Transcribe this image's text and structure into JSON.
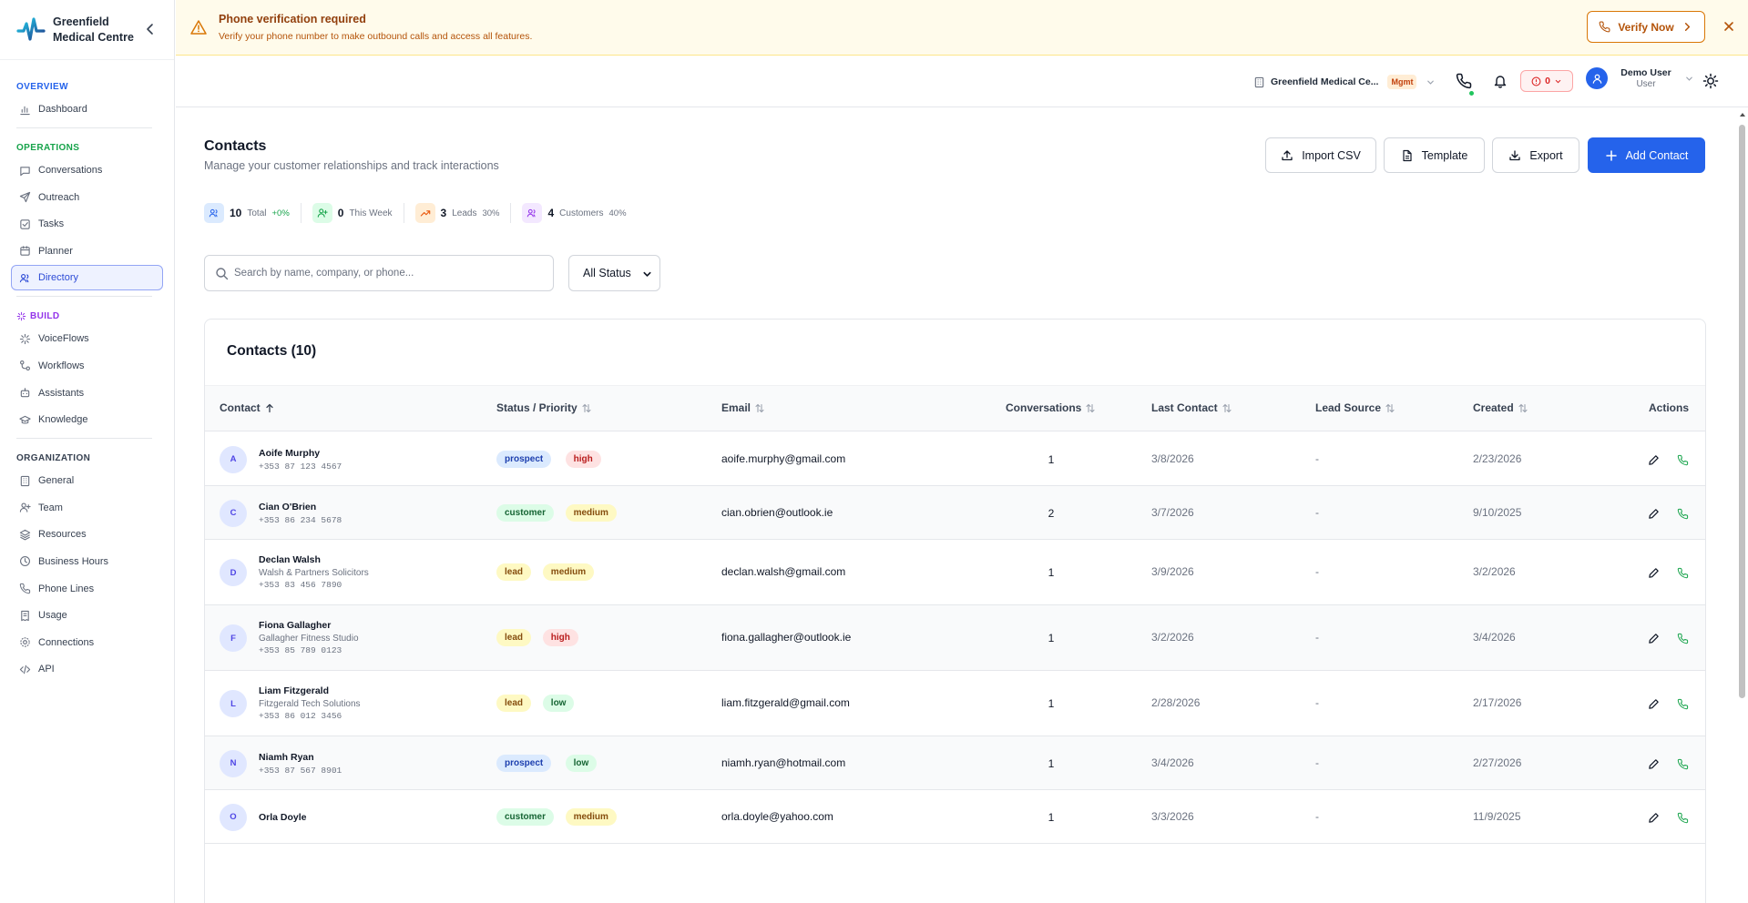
{
  "brand": {
    "name": "Greenfield Medical Centre"
  },
  "sidebar": {
    "sections": [
      {
        "title": "OVERVIEW",
        "color": "#2563eb",
        "items": [
          {
            "label": "Dashboard",
            "icon": "chart-bar-icon"
          }
        ]
      },
      {
        "title": "OPERATIONS",
        "color": "#16a34a",
        "items": [
          {
            "label": "Conversations",
            "icon": "message-icon"
          },
          {
            "label": "Outreach",
            "icon": "send-icon"
          },
          {
            "label": "Tasks",
            "icon": "checkbox-icon"
          },
          {
            "label": "Planner",
            "icon": "calendar-icon"
          },
          {
            "label": "Directory",
            "icon": "users-icon",
            "active": true
          }
        ]
      },
      {
        "title": "BUILD",
        "color": "#9333ea",
        "items": [
          {
            "label": "VoiceFlows",
            "icon": "sparkle-icon"
          },
          {
            "label": "Workflows",
            "icon": "workflow-icon"
          },
          {
            "label": "Assistants",
            "icon": "bot-icon"
          },
          {
            "label": "Knowledge",
            "icon": "graduation-icon"
          }
        ]
      },
      {
        "title": "ORGANIZATION",
        "color": "#374151",
        "items": [
          {
            "label": "General",
            "icon": "building-icon"
          },
          {
            "label": "Team",
            "icon": "user-plus-icon"
          },
          {
            "label": "Resources",
            "icon": "layers-icon"
          },
          {
            "label": "Business Hours",
            "icon": "clock-icon"
          },
          {
            "label": "Phone Lines",
            "icon": "phone-icon"
          },
          {
            "label": "Usage",
            "icon": "receipt-icon"
          },
          {
            "label": "Connections",
            "icon": "settings-icon"
          },
          {
            "label": "API",
            "icon": "code-icon"
          }
        ]
      }
    ]
  },
  "banner": {
    "title": "Phone verification required",
    "subtitle": "Verify your phone number to make outbound calls and access all features.",
    "action_label": "Verify Now"
  },
  "topbar": {
    "org_name": "Greenfield Medical Ce...",
    "org_badge": "Mgmt",
    "alerts_count": "0",
    "user_name": "Demo User",
    "user_role": "User"
  },
  "page": {
    "title": "Contacts",
    "subtitle": "Manage your customer relationships and track interactions",
    "buttons": {
      "import": "Import CSV",
      "template": "Template",
      "export": "Export",
      "add": "Add Contact"
    }
  },
  "stats": [
    {
      "value": "10",
      "label": "Total",
      "extra": "+0%",
      "color": "#2563eb",
      "bg": "#dbeafe",
      "icon": "users-icon"
    },
    {
      "value": "0",
      "label": "This Week",
      "extra": "",
      "color": "#16a34a",
      "bg": "#dcfce7",
      "icon": "user-plus-icon"
    },
    {
      "value": "3",
      "label": "Leads",
      "extra": "30%",
      "color": "#ea580c",
      "bg": "#ffedd5",
      "icon": "trending-up-icon"
    },
    {
      "value": "4",
      "label": "Customers",
      "extra": "40%",
      "color": "#9333ea",
      "bg": "#f3e8ff",
      "icon": "users-icon"
    }
  ],
  "search": {
    "placeholder": "Search by name, company, or phone...",
    "value": ""
  },
  "status_filter": {
    "selected": "All Status"
  },
  "table": {
    "title": "Contacts (10)",
    "columns": {
      "contact": "Contact",
      "status": "Status / Priority",
      "email": "Email",
      "conversations": "Conversations",
      "last_contact": "Last Contact",
      "lead_source": "Lead Source",
      "created": "Created",
      "actions": "Actions"
    },
    "rows": [
      {
        "initial": "A",
        "name": "Aoife Murphy",
        "company": "",
        "phone": "+353 87 123 4567",
        "status": "prospect",
        "priority": "high",
        "email": "aoife.murphy@gmail.com",
        "conversations": "1",
        "last_contact": "3/8/2026",
        "lead_source": "-",
        "created": "2/23/2026"
      },
      {
        "initial": "C",
        "name": "Cian O'Brien",
        "company": "",
        "phone": "+353 86 234 5678",
        "status": "customer",
        "priority": "medium",
        "email": "cian.obrien@outlook.ie",
        "conversations": "2",
        "last_contact": "3/7/2026",
        "lead_source": "-",
        "created": "9/10/2025"
      },
      {
        "initial": "D",
        "name": "Declan Walsh",
        "company": "Walsh & Partners Solicitors",
        "phone": "+353 83 456 7890",
        "status": "lead",
        "priority": "medium",
        "email": "declan.walsh@gmail.com",
        "conversations": "1",
        "last_contact": "3/9/2026",
        "lead_source": "-",
        "created": "3/2/2026"
      },
      {
        "initial": "F",
        "name": "Fiona Gallagher",
        "company": "Gallagher Fitness Studio",
        "phone": "+353 85 789 0123",
        "status": "lead",
        "priority": "high",
        "email": "fiona.gallagher@outlook.ie",
        "conversations": "1",
        "last_contact": "3/2/2026",
        "lead_source": "-",
        "created": "3/4/2026"
      },
      {
        "initial": "L",
        "name": "Liam Fitzgerald",
        "company": "Fitzgerald Tech Solutions",
        "phone": "+353 86 012 3456",
        "status": "lead",
        "priority": "low",
        "email": "liam.fitzgerald@gmail.com",
        "conversations": "1",
        "last_contact": "2/28/2026",
        "lead_source": "-",
        "created": "2/17/2026"
      },
      {
        "initial": "N",
        "name": "Niamh Ryan",
        "company": "",
        "phone": "+353 87 567 8901",
        "status": "prospect",
        "priority": "low",
        "email": "niamh.ryan@hotmail.com",
        "conversations": "1",
        "last_contact": "3/4/2026",
        "lead_source": "-",
        "created": "2/27/2026"
      },
      {
        "initial": "O",
        "name": "Orla Doyle",
        "company": "",
        "phone": "",
        "status": "customer",
        "priority": "medium",
        "email": "orla.doyle@yahoo.com",
        "conversations": "1",
        "last_contact": "3/3/2026",
        "lead_source": "-",
        "created": "11/9/2025"
      }
    ]
  }
}
